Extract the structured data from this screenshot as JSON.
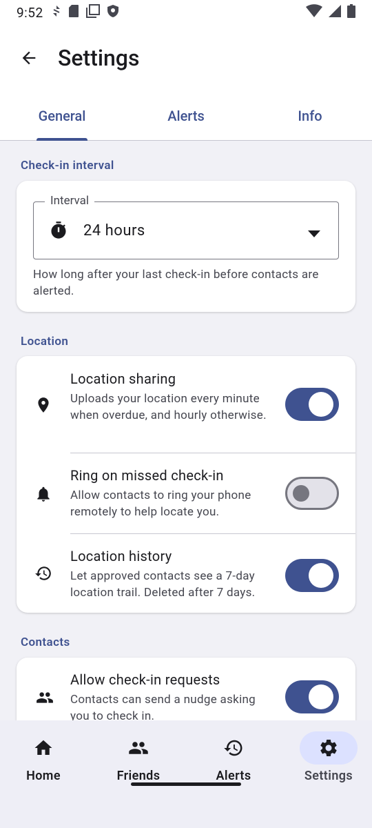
{
  "status_bar": {
    "time": "9:52",
    "left_icons": [
      "data-saver-icon",
      "sd-card-icon",
      "screenshot-icon",
      "shield-icon"
    ],
    "right_icons": [
      "wifi-icon",
      "signal-icon",
      "battery-icon"
    ]
  },
  "header": {
    "title": "Settings",
    "back_icon": "back-arrow-icon"
  },
  "tabs": [
    {
      "label": "General",
      "active": true
    },
    {
      "label": "Alerts",
      "active": false
    },
    {
      "label": "Info",
      "active": false
    }
  ],
  "checkin": {
    "section_label": "Check-in interval",
    "field_label": "Interval",
    "field_value": "24 hours",
    "field_icon": "timer-icon",
    "helper": "How long after your last check-in before contacts are alerted."
  },
  "location": {
    "section_label": "Location",
    "items": [
      {
        "title": "Location sharing",
        "desc": "Uploads your location every minute when overdue, and hourly otherwise.",
        "icon": "location-pin-icon",
        "enabled": true
      },
      {
        "title": "Ring on missed check-in",
        "desc": "Allow contacts to ring your phone remotely to help locate you.",
        "icon": "bell-icon",
        "enabled": false
      },
      {
        "title": "Location history",
        "desc": "Let approved contacts see a 7-day location trail. Deleted after 7 days.",
        "icon": "history-icon",
        "enabled": true
      }
    ]
  },
  "contacts": {
    "section_label": "Contacts",
    "items": [
      {
        "title": "Allow check-in requests",
        "desc": "Contacts can send a nudge asking you to check in.",
        "icon": "people-icon",
        "enabled": true
      }
    ]
  },
  "bottom_nav": [
    {
      "label": "Home",
      "icon": "home-icon",
      "active": false
    },
    {
      "label": "Friends",
      "icon": "people-icon",
      "active": false
    },
    {
      "label": "Alerts",
      "icon": "history-icon",
      "active": false
    },
    {
      "label": "Settings",
      "icon": "gear-icon",
      "active": true
    }
  ],
  "colors": {
    "primary": "#3F5290",
    "background": "#F1F1F6",
    "surface": "#FFFFFF",
    "nav_background": "#EEEEF6",
    "nav_active_pill": "#DCE1FF"
  }
}
